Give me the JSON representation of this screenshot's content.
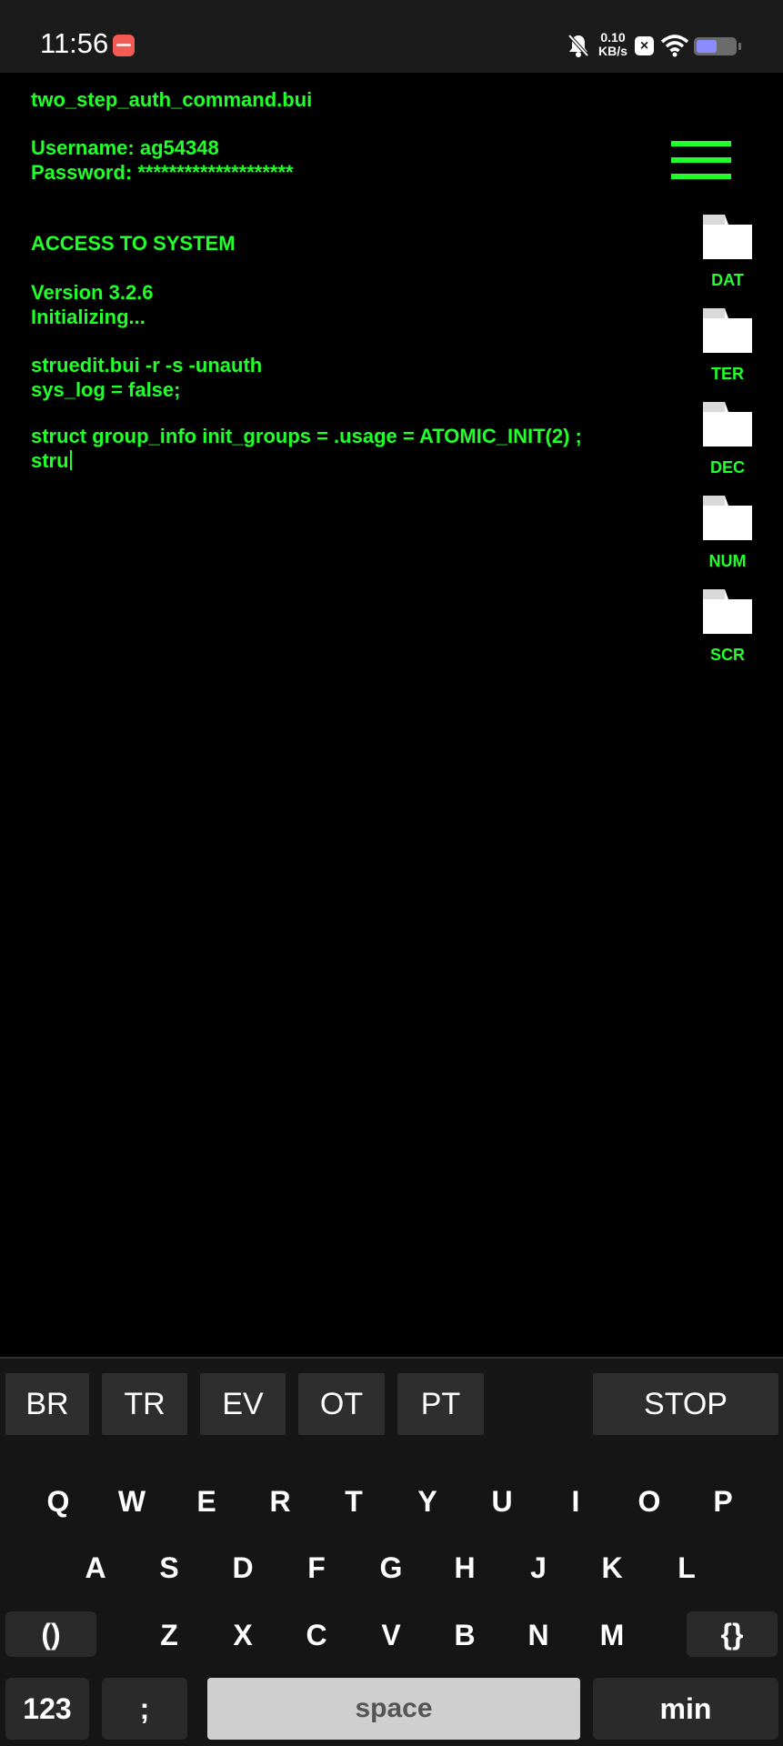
{
  "status_bar": {
    "time": "11:56",
    "net_speed_value": "0.10",
    "net_speed_unit": "KB/s",
    "icons": [
      "app-notification-icon",
      "bell-muted-icon",
      "close-icon",
      "wifi-icon",
      "battery-icon"
    ]
  },
  "terminal": {
    "file_name": "two_step_auth_command.bui",
    "username_line": "Username: ag54348",
    "password_line": "Password: ********************",
    "access_line": "ACCESS TO SYSTEM",
    "version_line": "Version 3.2.6",
    "init_line": "Initializing...",
    "cmd_line": "struedit.bui -r -s -unauth",
    "syslog_line": "sys_log = false;",
    "struct_line": "struct group_info init_groups = .usage = ATOMIC_INIT(2) ;",
    "typing_line": "stru"
  },
  "side_panel": {
    "folders": [
      {
        "label": "DAT"
      },
      {
        "label": "TER"
      },
      {
        "label": "DEC"
      },
      {
        "label": "NUM"
      },
      {
        "label": "SCR"
      }
    ]
  },
  "action_bar": {
    "buttons": [
      "BR",
      "TR",
      "EV",
      "OT",
      "PT"
    ],
    "stop_label": "STOP"
  },
  "keyboard": {
    "row1": [
      "Q",
      "W",
      "E",
      "R",
      "T",
      "Y",
      "U",
      "I",
      "O",
      "P"
    ],
    "row2": [
      "A",
      "S",
      "D",
      "F",
      "G",
      "H",
      "J",
      "K",
      "L"
    ],
    "row3_left": "()",
    "row3": [
      "Z",
      "X",
      "C",
      "V",
      "B",
      "N",
      "M"
    ],
    "row3_right": "{}",
    "numbers_label": "123",
    "semicolon_label": ";",
    "space_label": "space",
    "min_label": "min"
  },
  "colors": {
    "terminal_green": "#21ff2a",
    "background": "#000000",
    "keyboard_bg": "#151515"
  }
}
